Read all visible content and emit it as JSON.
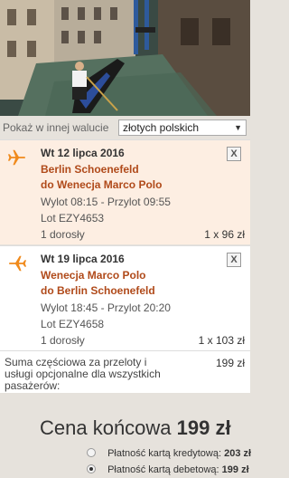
{
  "currency": {
    "label": "Pokaż w innej walucie",
    "selected": "złotych polskich"
  },
  "flights": [
    {
      "date": "Wt 12 lipca 2016",
      "from": "Berlin Schoenefeld",
      "to": "do Wenecja Marco Polo",
      "times": "Wylot 08:15 - Przylot 09:55",
      "flight_no": "Lot EZY4653",
      "passengers": "1 dorosły",
      "price": "1 x 96 zł",
      "remove": "X",
      "icon": "plane-icon"
    },
    {
      "date": "Wt 19 lipca 2016",
      "from": "Wenecja Marco Polo",
      "to": "do Berlin Schoenefeld",
      "times": "Wylot 18:45 - Przylot 20:20",
      "flight_no": "Lot EZY4658",
      "passengers": "1 dorosły",
      "price": "1 x 103 zł",
      "remove": "X",
      "icon": "plane-icon"
    }
  ],
  "subtotal": {
    "label": "Suma częściowa za przeloty i usługi opcjonalne dla wszystkich pasażerów:",
    "amount": "199 zł"
  },
  "final": {
    "label": "Cena końcowa",
    "amount": "199 zł"
  },
  "payment": {
    "credit": {
      "label": "Płatność kartą kredytową:",
      "amount": "203 zł",
      "selected": false
    },
    "debit": {
      "label": "Płatność kartą debetową:",
      "amount": "199 zł",
      "selected": true
    }
  },
  "colors": {
    "accent_orange": "#f08a1c",
    "route_text": "#b04a1a",
    "highlight_bg": "#fdeee2",
    "page_bg": "#e6e2dc"
  }
}
